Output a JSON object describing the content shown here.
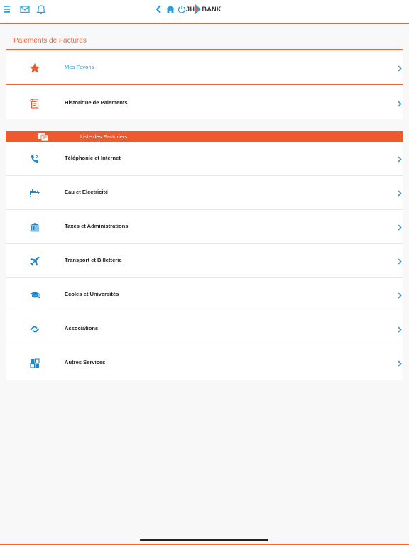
{
  "header": {
    "brand_prefix": "JH",
    "brand_name": "BANK",
    "icons": [
      "menu-icon",
      "mail-icon",
      "bell-icon",
      "back-icon",
      "home-icon",
      "power-icon"
    ]
  },
  "page": {
    "title": "Paiements de Factures"
  },
  "top_items": [
    {
      "label": "Mes Favoris",
      "icon": "star-icon"
    },
    {
      "label": "Historique de Paiements",
      "icon": "receipt-icon"
    }
  ],
  "billers": {
    "title": "Liste des Facturiers",
    "items": [
      {
        "label": "Téléphonie et Internet",
        "icon": "phone-icon"
      },
      {
        "label": "Eau et Electricité",
        "icon": "faucet-icon"
      },
      {
        "label": "Taxes et Administrations",
        "icon": "bank-building-icon"
      },
      {
        "label": "Transport et Billetterie",
        "icon": "airplane-icon"
      },
      {
        "label": "Ecoles et Universités",
        "icon": "graduation-cap-icon"
      },
      {
        "label": "Associations",
        "icon": "handshake-icon"
      },
      {
        "label": "Autres Services",
        "icon": "grid-icon"
      }
    ]
  },
  "colors": {
    "accent": "#f0643a",
    "link_blue": "#2e9fdc",
    "icon_blue": "#1e86c8"
  }
}
